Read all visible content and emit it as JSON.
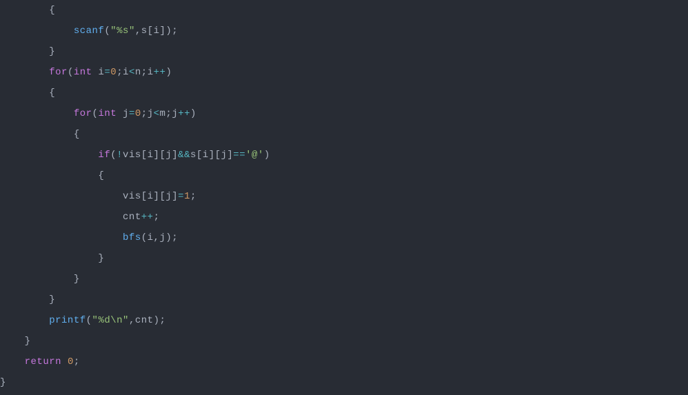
{
  "code": {
    "lines": [
      {
        "indent": "        ",
        "tokens": [
          {
            "text": "{",
            "class": "brace"
          }
        ]
      },
      {
        "indent": "            ",
        "tokens": [
          {
            "text": "scanf",
            "class": "function"
          },
          {
            "text": "(",
            "class": "paren"
          },
          {
            "text": "\"%s\"",
            "class": "string"
          },
          {
            "text": ",s[i]);",
            "class": "punctuation"
          }
        ]
      },
      {
        "indent": "        ",
        "tokens": [
          {
            "text": "}",
            "class": "brace"
          }
        ]
      },
      {
        "indent": "        ",
        "tokens": [
          {
            "text": "for",
            "class": "keyword"
          },
          {
            "text": "(",
            "class": "paren"
          },
          {
            "text": "int",
            "class": "type"
          },
          {
            "text": " i",
            "class": "variable"
          },
          {
            "text": "=",
            "class": "operator"
          },
          {
            "text": "0",
            "class": "number"
          },
          {
            "text": ";i",
            "class": "variable"
          },
          {
            "text": "<",
            "class": "operator"
          },
          {
            "text": "n;i",
            "class": "variable"
          },
          {
            "text": "++",
            "class": "operator"
          },
          {
            "text": ")",
            "class": "paren"
          }
        ]
      },
      {
        "indent": "        ",
        "tokens": [
          {
            "text": "{",
            "class": "brace"
          }
        ]
      },
      {
        "indent": "            ",
        "tokens": [
          {
            "text": "for",
            "class": "keyword"
          },
          {
            "text": "(",
            "class": "paren"
          },
          {
            "text": "int",
            "class": "type"
          },
          {
            "text": " j",
            "class": "variable"
          },
          {
            "text": "=",
            "class": "operator"
          },
          {
            "text": "0",
            "class": "number"
          },
          {
            "text": ";j",
            "class": "variable"
          },
          {
            "text": "<",
            "class": "operator"
          },
          {
            "text": "m;j",
            "class": "variable"
          },
          {
            "text": "++",
            "class": "operator"
          },
          {
            "text": ")",
            "class": "paren"
          }
        ]
      },
      {
        "indent": "            ",
        "tokens": [
          {
            "text": "{",
            "class": "brace"
          }
        ]
      },
      {
        "indent": "                ",
        "tokens": [
          {
            "text": "if",
            "class": "keyword"
          },
          {
            "text": "(",
            "class": "paren"
          },
          {
            "text": "!",
            "class": "operator"
          },
          {
            "text": "vis[i][j]",
            "class": "variable"
          },
          {
            "text": "&&",
            "class": "operator"
          },
          {
            "text": "s[i][j]",
            "class": "variable"
          },
          {
            "text": "==",
            "class": "operator"
          },
          {
            "text": "'@'",
            "class": "string"
          },
          {
            "text": ")",
            "class": "paren"
          }
        ]
      },
      {
        "indent": "                ",
        "tokens": [
          {
            "text": "{",
            "class": "brace"
          }
        ]
      },
      {
        "indent": "                    ",
        "tokens": [
          {
            "text": "vis[i][j]",
            "class": "variable"
          },
          {
            "text": "=",
            "class": "operator"
          },
          {
            "text": "1",
            "class": "number"
          },
          {
            "text": ";",
            "class": "punctuation"
          }
        ]
      },
      {
        "indent": "                    ",
        "tokens": [
          {
            "text": "cnt",
            "class": "variable"
          },
          {
            "text": "++",
            "class": "operator"
          },
          {
            "text": ";",
            "class": "punctuation"
          }
        ]
      },
      {
        "indent": "                    ",
        "tokens": [
          {
            "text": "bfs",
            "class": "function"
          },
          {
            "text": "(i,j);",
            "class": "punctuation"
          }
        ]
      },
      {
        "indent": "                ",
        "tokens": [
          {
            "text": "}",
            "class": "brace"
          }
        ]
      },
      {
        "indent": "            ",
        "tokens": [
          {
            "text": "}",
            "class": "brace"
          }
        ]
      },
      {
        "indent": "        ",
        "tokens": [
          {
            "text": "}",
            "class": "brace"
          }
        ]
      },
      {
        "indent": "        ",
        "tokens": [
          {
            "text": "printf",
            "class": "function"
          },
          {
            "text": "(",
            "class": "paren"
          },
          {
            "text": "\"%d\\n\"",
            "class": "string"
          },
          {
            "text": ",cnt);",
            "class": "punctuation"
          }
        ]
      },
      {
        "indent": "    ",
        "tokens": [
          {
            "text": "}",
            "class": "brace"
          }
        ]
      },
      {
        "indent": "    ",
        "tokens": [
          {
            "text": "return",
            "class": "keyword"
          },
          {
            "text": " ",
            "class": "variable"
          },
          {
            "text": "0",
            "class": "number"
          },
          {
            "text": ";",
            "class": "punctuation"
          }
        ]
      },
      {
        "indent": "",
        "tokens": [
          {
            "text": "}",
            "class": "brace"
          }
        ]
      }
    ]
  }
}
